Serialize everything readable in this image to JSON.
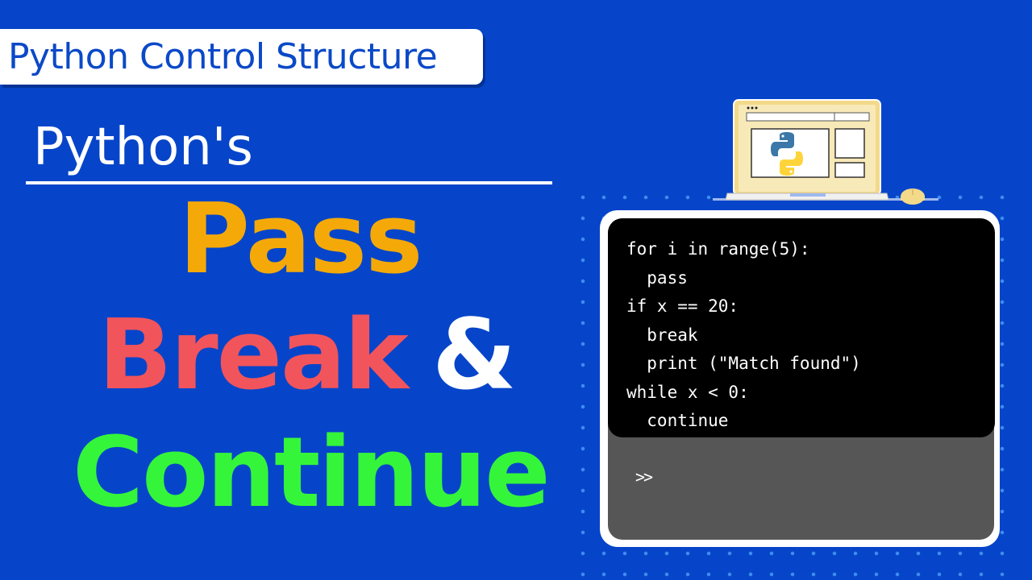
{
  "tag": {
    "label": "Python Control Structure"
  },
  "subtitle": "Python's",
  "headline": {
    "pass": "Pass",
    "break": "Break",
    "amp": "&",
    "continue": "Continue"
  },
  "code_lines": [
    "for i in range(5):",
    "  pass",
    "if x == 20:",
    "  break",
    "  print (\"Match found\")",
    "while x < 0:",
    "  continue"
  ],
  "prompt": ">>",
  "icons": {
    "illustration": "laptop-icon",
    "logo": "python-logo-icon"
  },
  "colors": {
    "background": "#0645c9",
    "pass": "#f5a908",
    "break": "#f2545b",
    "continue": "#35f53b",
    "tag_text": "#0a49c8"
  }
}
